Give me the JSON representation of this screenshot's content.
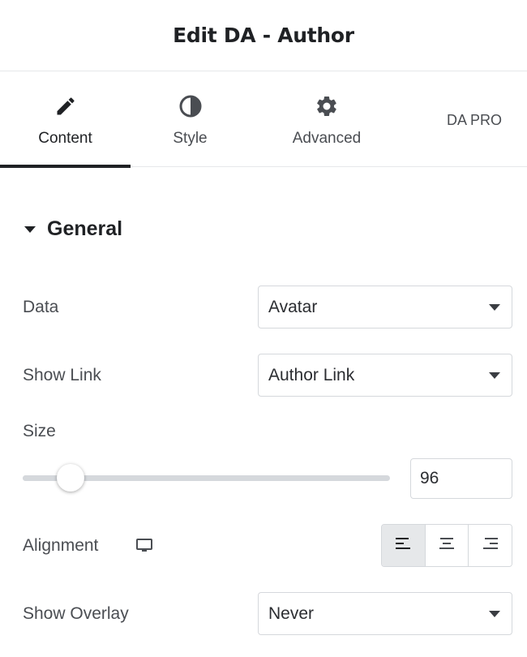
{
  "header": {
    "title": "Edit DA - Author"
  },
  "tabs": [
    {
      "label": "Content",
      "icon": "pencil-icon",
      "active": true
    },
    {
      "label": "Style",
      "icon": "half-circle-icon",
      "active": false
    },
    {
      "label": "Advanced",
      "icon": "gear-icon",
      "active": false
    },
    {
      "label": "DA PRO",
      "icon": "",
      "active": false
    }
  ],
  "section": {
    "title": "General",
    "expanded": true
  },
  "controls": {
    "data": {
      "label": "Data",
      "value": "Avatar"
    },
    "show_link": {
      "label": "Show Link",
      "value": "Author Link"
    },
    "size": {
      "label": "Size",
      "value": "96",
      "slider_fraction": 0.13
    },
    "alignment": {
      "label": "Alignment",
      "device_icon": "desktop-icon",
      "options": [
        "left",
        "center",
        "right"
      ],
      "selected": "left"
    },
    "show_overlay": {
      "label": "Show Overlay",
      "value": "Never"
    }
  },
  "colors": {
    "text": "#1f2124",
    "muted": "#4a4d52",
    "border": "#d5d8dc",
    "active_bg": "#e6e8ea"
  }
}
